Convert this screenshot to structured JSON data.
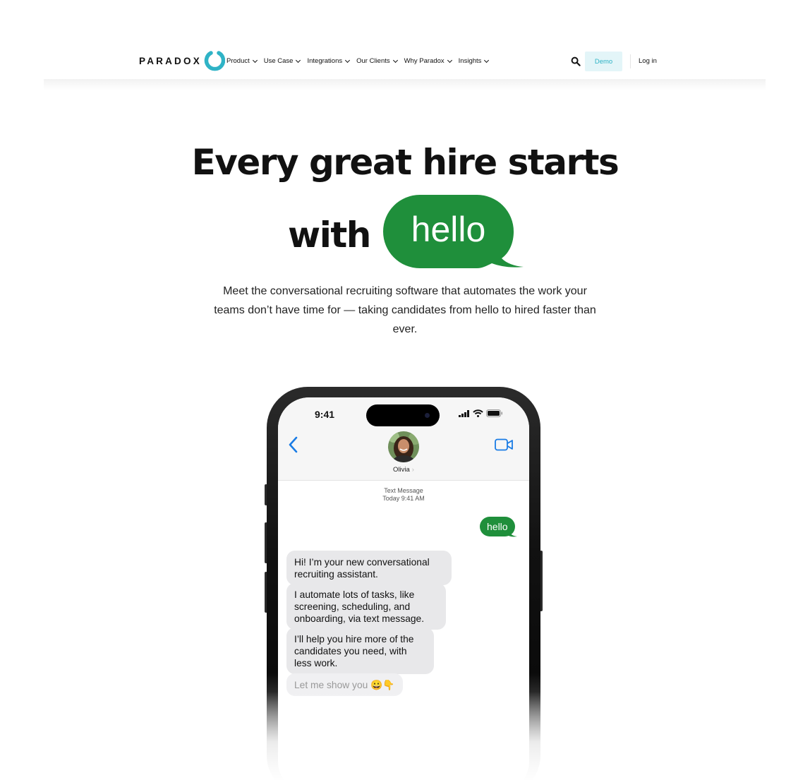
{
  "nav": {
    "logo_text": "PARADOX",
    "menu": [
      {
        "label": "Product"
      },
      {
        "label": "Use Case"
      },
      {
        "label": "Integrations"
      },
      {
        "label": "Our Clients"
      },
      {
        "label": "Why Paradox"
      },
      {
        "label": "Insights"
      }
    ],
    "demo_label": "Demo",
    "login_label": "Log in"
  },
  "hero": {
    "headline_line1": "Every great hire starts",
    "headline_line2": "with",
    "bubble_word": "hello",
    "subtitle": "Meet the conversational recruiting software that automates the work your teams don’t have time for — taking candidates from hello to hired faster than ever."
  },
  "phone": {
    "time": "9:41",
    "contact_name": "Olivia",
    "message_type": "Text Message",
    "timestamp": "Today 9:41 AM",
    "outgoing": "hello",
    "messages": [
      "Hi! I’m your new conversational recruiting assistant.",
      "I automate lots of tasks, like screening, scheduling, and onboarding, via text message.",
      "I’ll help you hire more of the candidates you need, with less work.",
      "Let me show you 😀👇"
    ]
  },
  "colors": {
    "brand_green": "#1f8f3b",
    "brand_teal": "#2fb3c6",
    "demo_bg": "#e3f5f8"
  }
}
